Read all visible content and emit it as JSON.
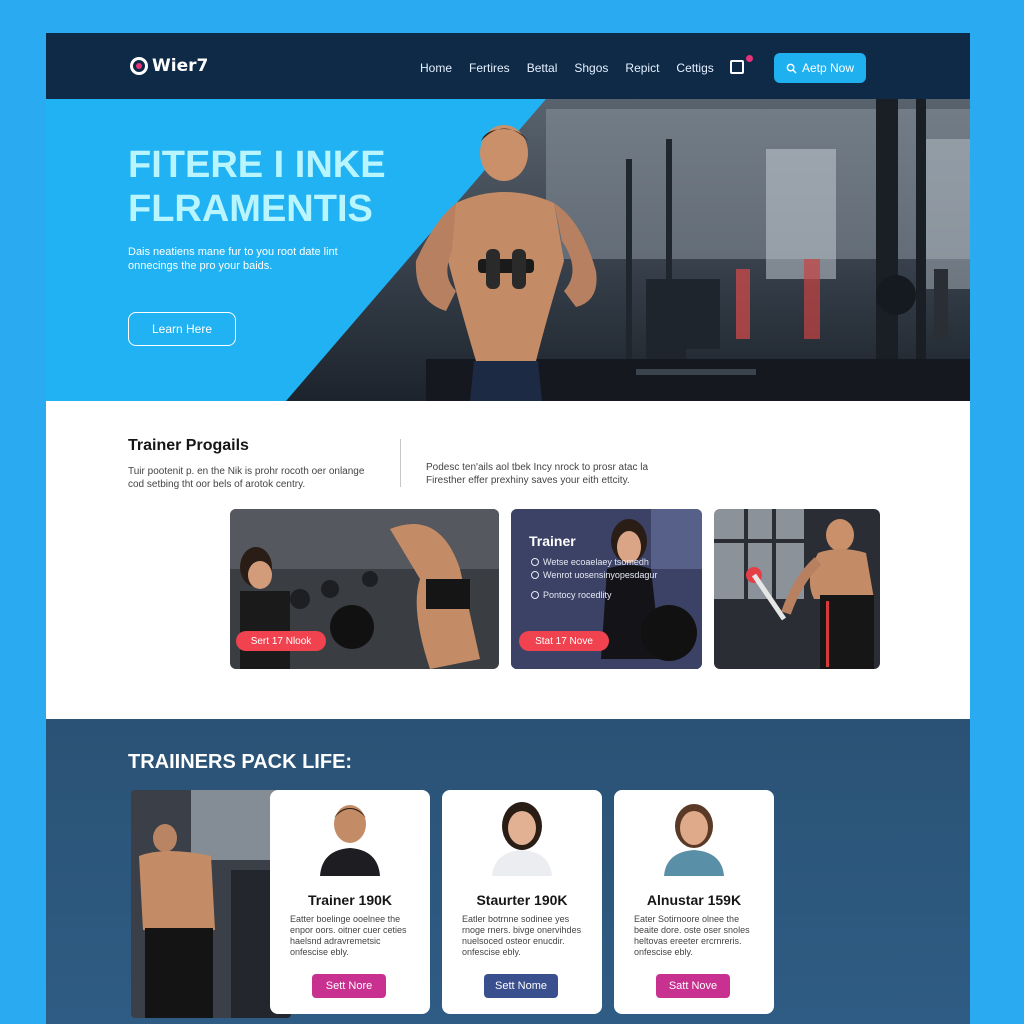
{
  "brand": {
    "name": "Wier7"
  },
  "nav": {
    "links": [
      "Home",
      "Fertires",
      "Bettal",
      "Shgos",
      "Repict",
      "Cettigs"
    ],
    "cta_label": "Aetp Now"
  },
  "hero": {
    "title_line1": "FITERE I INKE",
    "title_line2": "FLRAMENTIS",
    "subtitle": "Dais neatiens mane fur to you root date lint onnecings the pro your baids.",
    "button_label": "Learn Here"
  },
  "programs": {
    "title": "Trainer Progails",
    "description": "Tuir pootenit p. en the Nik is prohr rocoth oer onlange cod setbing tht oor bels of arotok centry.",
    "description2": "Podesc ten'ails aol tbek Incy nrock to prosr atac la Firesther effer prexhiny saves your eith ettcity.",
    "card1_button": "Sert 17 Nlook",
    "card2_title": "Trainer",
    "card2_items": [
      "Wetse ecoaelaey tsomedh",
      "Wenrot uosensinyopesdagur",
      "Pontocy rocedlity"
    ],
    "card2_button": "Stat 17 Nove"
  },
  "trainers": {
    "title": "TRAIINERS PACK LIFE:",
    "cards": [
      {
        "name": "Trainer 190K",
        "desc": "Eatter boelinge ooelnee the enpor oors. oitner cuer ceties haelsnd adravremetsic onfescise ebly.",
        "button": "Sett Nore",
        "color": "#c8318f"
      },
      {
        "name": "Staurter 190K",
        "desc": "Eatler botrnne sodinee yes rnoge rners. bivge onervihdes nuelsoced osteor enucdir. onfescise ebly.",
        "button": "Sett Nome",
        "color": "#3a4f8e"
      },
      {
        "name": "Alnustar 159K",
        "desc": "Eater Sotirnoore olnee the beaite dore. oste oser snoles heltovas ereeter ercrnreris. onfescise ebly.",
        "button": "Satt Nove",
        "color": "#c8318f"
      }
    ]
  },
  "colors": {
    "nav": "#0e2a47",
    "accent": "#20b2f2",
    "pill": "#f0434f",
    "magenta": "#c8318f"
  }
}
